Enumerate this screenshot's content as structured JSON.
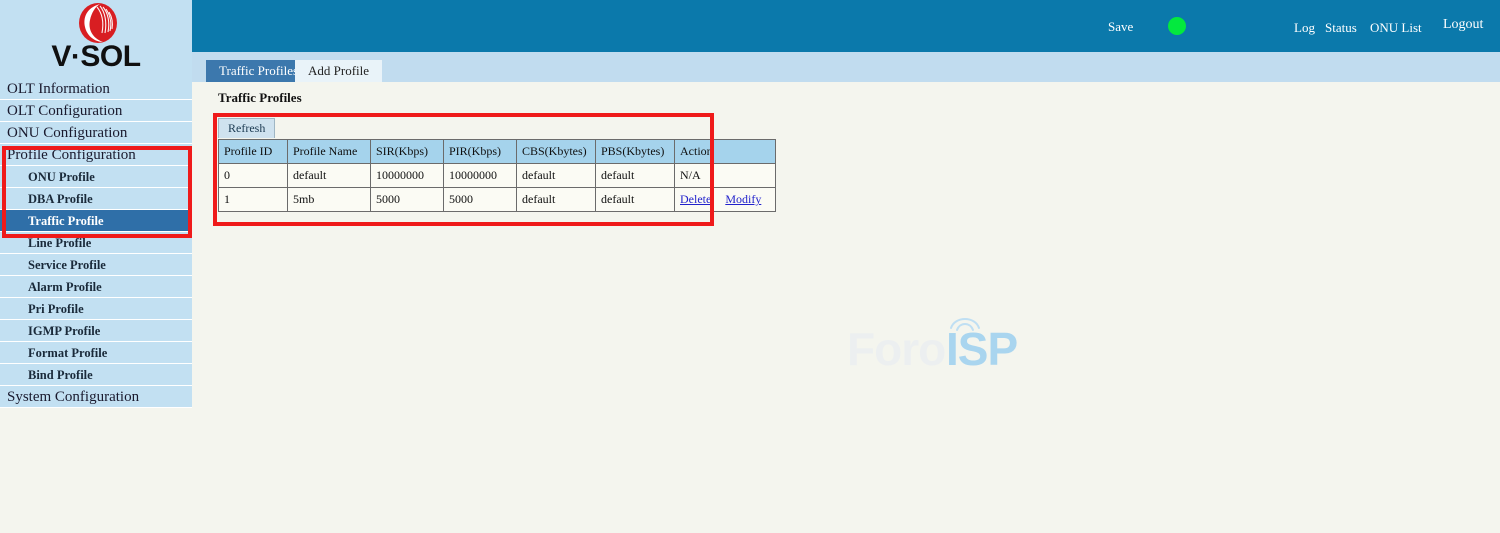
{
  "brand": {
    "wordmark": "V·SOL",
    "logo_icon": "vsol-circle-logo-icon",
    "logo_color": "#d81e22"
  },
  "header": {
    "save_label": "Save",
    "status_indicator": {
      "icon": "status-dot-icon",
      "color": "#03e93e"
    },
    "links": [
      {
        "label": "Log"
      },
      {
        "label": "Status"
      },
      {
        "label": "ONU List"
      },
      {
        "label": "Logout"
      }
    ],
    "background": "#0b79ab"
  },
  "sidebar": {
    "items": [
      {
        "label": "OLT Information",
        "level": "top",
        "selected": false
      },
      {
        "label": "OLT Configuration",
        "level": "top",
        "selected": false
      },
      {
        "label": "ONU Configuration",
        "level": "top",
        "selected": false
      },
      {
        "label": "Profile Configuration",
        "level": "top",
        "selected": false
      },
      {
        "label": "ONU Profile",
        "level": "sub",
        "selected": false
      },
      {
        "label": "DBA Profile",
        "level": "sub",
        "selected": false
      },
      {
        "label": "Traffic Profile",
        "level": "sub",
        "selected": true
      },
      {
        "label": "Line Profile",
        "level": "sub",
        "selected": false
      },
      {
        "label": "Service Profile",
        "level": "sub",
        "selected": false
      },
      {
        "label": "Alarm Profile",
        "level": "sub",
        "selected": false
      },
      {
        "label": "Pri Profile",
        "level": "sub",
        "selected": false
      },
      {
        "label": "IGMP Profile",
        "level": "sub",
        "selected": false
      },
      {
        "label": "Format Profile",
        "level": "sub",
        "selected": false
      },
      {
        "label": "Bind Profile",
        "level": "sub",
        "selected": false
      },
      {
        "label": "System Configuration",
        "level": "top",
        "selected": false
      }
    ],
    "selected_color": "#2f6fa8",
    "item_color": "#c2e0f2"
  },
  "tabs": [
    {
      "label": "Traffic Profiles",
      "active": true
    },
    {
      "label": "Add Profile",
      "active": false
    }
  ],
  "main": {
    "section_title": "Traffic Profiles",
    "refresh_label": "Refresh",
    "table": {
      "columns": [
        "Profile ID",
        "Profile Name",
        "SIR(Kbps)",
        "PIR(Kbps)",
        "CBS(Kbytes)",
        "PBS(Kbytes)",
        "Action"
      ],
      "rows": [
        {
          "profile_id": "0",
          "profile_name": "default",
          "sir": "10000000",
          "pir": "10000000",
          "cbs": "default",
          "pbs": "default",
          "action_text": "N/A",
          "action_links": []
        },
        {
          "profile_id": "1",
          "profile_name": "5mb",
          "sir": "5000",
          "pir": "5000",
          "cbs": "default",
          "pbs": "default",
          "action_text": "",
          "action_links": [
            {
              "label": "Delete"
            },
            {
              "label": "Modify"
            }
          ]
        }
      ]
    }
  },
  "annotations": {
    "color": "#ef1a1a",
    "boxes": [
      {
        "target": "sidebar-profile-configuration-group"
      },
      {
        "target": "traffic-profiles-table"
      }
    ]
  },
  "watermark": {
    "text_light": "Foro",
    "text_accent": "ISP",
    "accent_color": "#a9d5ef",
    "icon": "wifi-signal-icon"
  }
}
